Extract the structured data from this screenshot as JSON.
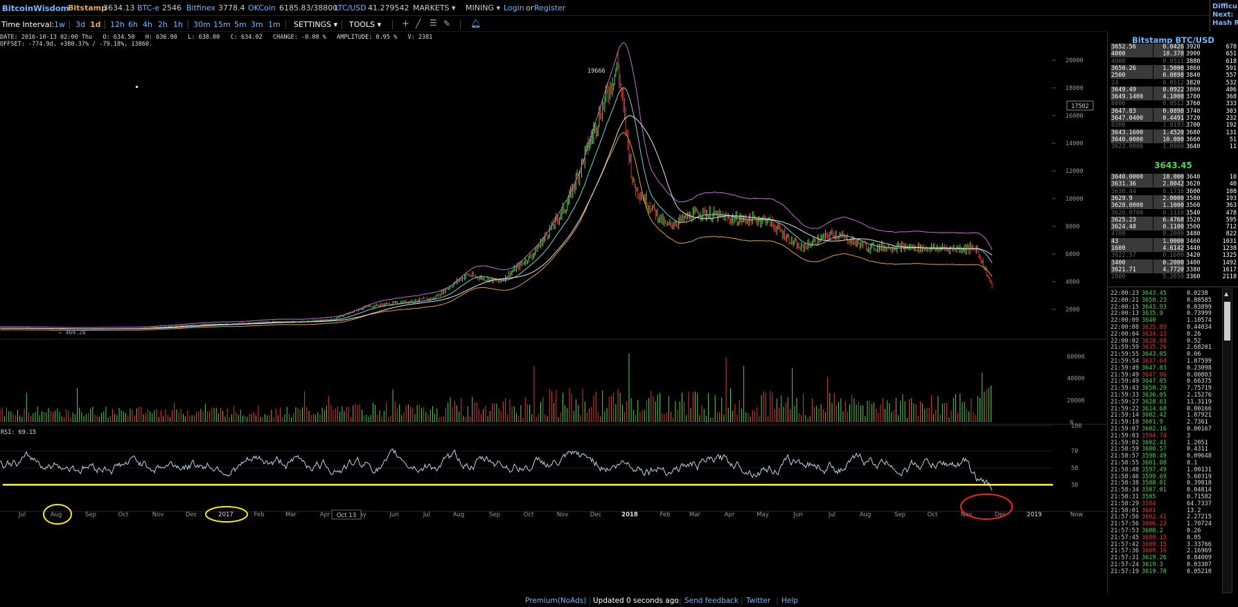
{
  "topbar": {
    "brand": "BitcoinWisdom",
    "tickers": [
      {
        "name": "Bitstamp",
        "value": "3634.13"
      },
      {
        "name": "BTC-e",
        "value": "2546"
      },
      {
        "name": "Bitfinex",
        "value": "3778.4"
      },
      {
        "name": "OKCoin",
        "value": "6185.83/38800"
      },
      {
        "name": "LTC/USD",
        "value": "41.279542"
      }
    ],
    "markets": "MARKETS",
    "mining": "MINING",
    "login": "Login",
    "or": "or",
    "register": "Register"
  },
  "corner": {
    "line1": "Difficu",
    "line2": "Next:",
    "line3": "Hash R"
  },
  "toolbar": {
    "label": "Time Interval:",
    "intervals": [
      "1w",
      "3d",
      "1d",
      "12h",
      "6h",
      "4h",
      "2h",
      "1h",
      "30m",
      "15m",
      "5m",
      "3m",
      "1m"
    ],
    "active_interval": "1d",
    "settings": "SETTINGS",
    "tools": "TOOLS"
  },
  "info": {
    "line1": "DATE: 2016-10-13 02:00 Thu   O: 634.50   H: 636.00   L: 630.00   C: 634.02   CHANGE: -0.08 %   AMPLITUDE: 0.95 %   V: 2381",
    "line2": "OFFSET: -774.9d, +380.37% / -79.18%, 13860."
  },
  "chart_data": {
    "type": "line",
    "title": "",
    "price_axis": {
      "ticks": [
        2000,
        4000,
        6000,
        8000,
        10000,
        12000,
        14000,
        16000,
        18000,
        20000
      ],
      "ylim": [
        0,
        21500
      ]
    },
    "volume_axis": {
      "ticks": [
        0,
        20000,
        40000,
        60000
      ],
      "ylim": [
        0,
        70000
      ]
    },
    "rsi_axis": {
      "ticks": [
        30,
        50,
        70,
        100
      ],
      "ylim": [
        0,
        100
      ]
    },
    "rsi_label": "RSI: 69.15",
    "rsi_line_level": 30,
    "annotations": {
      "peak_label": "19666",
      "cursor_price": "17502",
      "low_label": "469.28",
      "cursor_date": "Oct 13"
    },
    "x_labels": [
      "Jul",
      "Aug",
      "Sep",
      "Oct",
      "Nov",
      "Dec",
      "2017",
      "Feb",
      "Mar",
      "Apr",
      "May",
      "Jun",
      "Jul",
      "Aug",
      "Sep",
      "Oct",
      "Nov",
      "Dec",
      "2018",
      "Feb",
      "Mar",
      "Apr",
      "May",
      "Jun",
      "Jul",
      "Aug",
      "Sep",
      "Oct",
      "Nov",
      "Dec",
      "2019",
      "Now"
    ],
    "close_series": {
      "name": "Close",
      "points": [
        [
          "2016-06",
          650
        ],
        [
          "2016-08",
          580
        ],
        [
          "2016-10",
          620
        ],
        [
          "2016-12",
          900
        ],
        [
          "2017-01",
          950
        ],
        [
          "2017-02",
          1100
        ],
        [
          "2017-03",
          1100
        ],
        [
          "2017-04",
          1300
        ],
        [
          "2017-05",
          2200
        ],
        [
          "2017-06",
          2500
        ],
        [
          "2017-07",
          2800
        ],
        [
          "2017-08",
          4500
        ],
        [
          "2017-09",
          4000
        ],
        [
          "2017-10",
          6000
        ],
        [
          "2017-11",
          9500
        ],
        [
          "2017-12-17",
          19666
        ],
        [
          "2018-01",
          11000
        ],
        [
          "2018-02",
          8000
        ],
        [
          "2018-03",
          9000
        ],
        [
          "2018-04",
          8500
        ],
        [
          "2018-05",
          8500
        ],
        [
          "2018-06",
          6400
        ],
        [
          "2018-07",
          7500
        ],
        [
          "2018-08",
          6500
        ],
        [
          "2018-09",
          6500
        ],
        [
          "2018-10",
          6400
        ],
        [
          "2018-11-10",
          6400
        ],
        [
          "2018-11-24",
          3634
        ]
      ]
    }
  },
  "orderbook": {
    "title": "Bitstamp BTC/USD",
    "asks": [
      [
        "3652.56",
        "0.0426",
        "3920",
        "678"
      ],
      [
        "4000",
        "18.378",
        "3900",
        "651"
      ],
      [
        "4000",
        "0.0511",
        "3880",
        "618"
      ],
      [
        "3650.26",
        "1.5000",
        "3860",
        "591"
      ],
      [
        "2500",
        "0.0898",
        "3840",
        "557"
      ],
      [
        "24",
        "0.0512",
        "3820",
        "532"
      ],
      [
        "3649.49",
        "0.0922",
        "3800",
        "406"
      ],
      [
        "3649.1400",
        "4.1000",
        "3780",
        "368"
      ],
      [
        "0000",
        "0.0512",
        "3760",
        "333"
      ],
      [
        "3647.83",
        "0.0898",
        "3740",
        "303"
      ],
      [
        "3647.0400",
        "0.4491",
        "3720",
        "232"
      ],
      [
        "0300",
        "1.0193",
        "3700",
        "192"
      ],
      [
        "3643.1600",
        "1.4520",
        "3680",
        "131"
      ],
      [
        "3640.0000",
        "10.000",
        "3660",
        "51"
      ],
      [
        "3623.0000",
        "1.0000",
        "3640",
        "11"
      ]
    ],
    "last_price": "3643.45",
    "bids": [
      [
        "3640.0000",
        "10.000",
        "3640",
        "10"
      ],
      [
        "3631.36",
        "2.8042",
        "3620",
        "40"
      ],
      [
        "3630.44",
        "0.1738",
        "3600",
        "108"
      ],
      [
        "3629.9",
        "2.0000",
        "3580",
        "193"
      ],
      [
        "3628.0000",
        "1.1000",
        "3560",
        "363"
      ],
      [
        "3626.0700",
        "0.1110",
        "3540",
        "478"
      ],
      [
        "3625.23",
        "6.4768",
        "3520",
        "595"
      ],
      [
        "3624.48",
        "0.1100",
        "3500",
        "712"
      ],
      [
        "4700",
        "0.2000",
        "3480",
        "822"
      ],
      [
        "43",
        "1.0000",
        "3460",
        "1031"
      ],
      [
        "1600",
        "4.6142",
        "3440",
        "1238"
      ],
      [
        "3622.57",
        "0.1600",
        "3420",
        "1325"
      ],
      [
        "3400",
        "0.2000",
        "3400",
        "1492"
      ],
      [
        "3621.71",
        "4.7720",
        "3380",
        "1617"
      ],
      [
        "2800",
        "5.2650",
        "3360",
        "2118"
      ]
    ]
  },
  "trades": [
    [
      "22:00:23",
      "3643.45",
      "0.0238",
      "g"
    ],
    [
      "22:00:21",
      "3650.23",
      "0.88585",
      "g"
    ],
    [
      "22:00:15",
      "3643.93",
      "0.03899",
      "g"
    ],
    [
      "22:00:13",
      "3635.9",
      "0.73999",
      "g"
    ],
    [
      "22:00:09",
      "3640",
      "1.10574",
      "g"
    ],
    [
      "22:00:08",
      "3635.89",
      "0.44034",
      "r"
    ],
    [
      "22:00:04",
      "3634.13",
      "0.26",
      "r"
    ],
    [
      "22:00:02",
      "3628.08",
      "0.52",
      "r"
    ],
    [
      "21:59:59",
      "3635.26",
      "2.68201",
      "r"
    ],
    [
      "21:59:55",
      "3643.05",
      "0.06",
      "g"
    ],
    [
      "21:59:54",
      "3637.64",
      "1.07599",
      "r"
    ],
    [
      "21:59:49",
      "3647.83",
      "0.23098",
      "g"
    ],
    [
      "21:59:49",
      "3647.06",
      "0.00803",
      "r"
    ],
    [
      "21:59:49",
      "3647.05",
      "0.66375",
      "g"
    ],
    [
      "21:59:43",
      "3650.29",
      "7.75719",
      "g"
    ],
    [
      "21:59:33",
      "3636.05",
      "2.15276",
      "g"
    ],
    [
      "21:59:27",
      "3628.63",
      "11.3119",
      "g"
    ],
    [
      "21:59:22",
      "3614.68",
      "0.00166",
      "g"
    ],
    [
      "21:59:14",
      "3602.42",
      "1.07921",
      "g"
    ],
    [
      "21:59:10",
      "3601.9",
      "2.7361",
      "g"
    ],
    [
      "21:59:07",
      "3602.16",
      "0.00167",
      "g"
    ],
    [
      "21:59:03",
      "3594.74",
      "3",
      "r"
    ],
    [
      "21:59:02",
      "3602.41",
      "1.2051",
      "g"
    ],
    [
      "21:58:59",
      "3600.57",
      "0.4311",
      "g"
    ],
    [
      "21:58:57",
      "3598.49",
      "0.09648",
      "g"
    ],
    [
      "21:58:55",
      "3601.08",
      "0.1",
      "g"
    ],
    [
      "21:58:48",
      "3597.49",
      "1.00131",
      "g"
    ],
    [
      "21:58:46",
      "3599.69",
      "5.60319",
      "g"
    ],
    [
      "21:58:38",
      "3588.01",
      "0.39818",
      "g"
    ],
    [
      "21:58:34",
      "3587.01",
      "0.04814",
      "g"
    ],
    [
      "21:58:31",
      "3585",
      "0.71582",
      "g"
    ],
    [
      "21:58:29",
      "3584",
      "64.7337",
      "r"
    ],
    [
      "21:58:01",
      "3601",
      "13.2",
      "r"
    ],
    [
      "21:57:56",
      "3602.41",
      "2.27215",
      "r"
    ],
    [
      "21:57:56",
      "3606.23",
      "1.70724",
      "r"
    ],
    [
      "21:57:53",
      "3608.2",
      "0.26",
      "g"
    ],
    [
      "21:57:45",
      "3609.15",
      "0.05",
      "r"
    ],
    [
      "21:57:42",
      "3609.15",
      "3.33766",
      "r"
    ],
    [
      "21:57:36",
      "3609.16",
      "2.16969",
      "r"
    ],
    [
      "21:57:31",
      "3619.26",
      "0.84009",
      "g"
    ],
    [
      "21:57:24",
      "3619.3",
      "0.03307",
      "g"
    ],
    [
      "21:57:19",
      "3619.78",
      "0.05210",
      "g"
    ]
  ],
  "footer": {
    "premium": "Premium(NoAds)",
    "updated": "Updated 0 seconds ago",
    "feedback": "Send feedback",
    "twitter": "Twitter",
    "help": "Help"
  },
  "colors": {
    "background": "#000000",
    "link_blue": "#6fb8ff",
    "exchange_gold": "#e8a94a",
    "up_green": "#4fd64f",
    "down_red": "#e03b3b",
    "ma_white": "#e8e8e8",
    "ema_cyan": "#7fd3d9",
    "boll_purple": "#c46fd6",
    "boll_orange": "#e8a040",
    "rsi_line": "#b8d8ee",
    "rsi_threshold": "#ffff00",
    "circle_yellow": "#ffee00",
    "circle_red": "#ff2020"
  }
}
